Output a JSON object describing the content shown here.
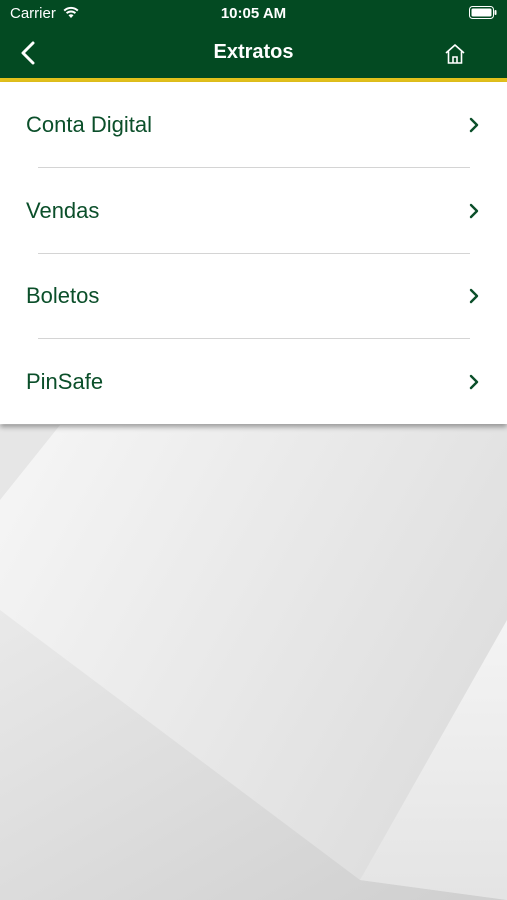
{
  "status_bar": {
    "carrier": "Carrier",
    "time": "10:05 AM"
  },
  "nav": {
    "title": "Extratos",
    "back_icon": "chevron-left-icon",
    "home_icon": "home-icon"
  },
  "menu": {
    "items": [
      {
        "label": "Conta Digital"
      },
      {
        "label": "Vendas"
      },
      {
        "label": "Boletos"
      },
      {
        "label": "PinSafe"
      }
    ]
  },
  "colors": {
    "header_green": "#034a22",
    "accent_yellow": "#e4c21c",
    "text_green": "#0b4f2a"
  }
}
